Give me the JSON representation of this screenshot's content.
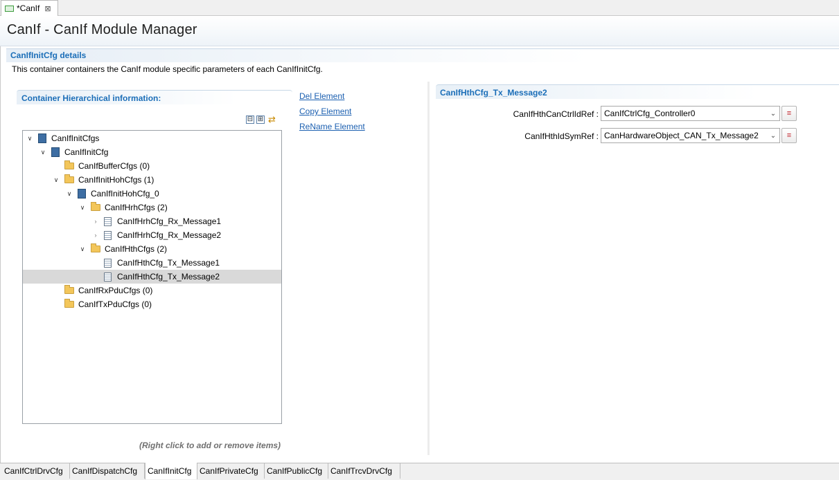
{
  "editor_tab": {
    "label": "*CanIf",
    "close": "⊠"
  },
  "form": {
    "title": "CanIf - CanIf Module Manager"
  },
  "section": {
    "title": "CanIfInitCfg details",
    "description": "This container containers the CanIf module specific parameters of each CanIfInitCfg."
  },
  "hierarchy": {
    "title": "Container Hierarchical information:",
    "hint": "(Right click to add or remove items)",
    "tools": [
      "⊟",
      "⊞",
      "⇄"
    ],
    "tree": [
      {
        "label": "CanIfInitCfgs",
        "twisty": "v",
        "icon": "book"
      },
      {
        "label": "CanIfInitCfg",
        "twisty": "v",
        "icon": "book"
      },
      {
        "label": "CanIfBufferCfgs (0)",
        "twisty": "",
        "icon": "folder"
      },
      {
        "label": "CanIfInitHohCfgs (1)",
        "twisty": "v",
        "icon": "folder"
      },
      {
        "label": "CanIfInitHohCfg_0",
        "twisty": "v",
        "icon": "book"
      },
      {
        "label": "CanIfHrhCfgs (2)",
        "twisty": "v",
        "icon": "folder"
      },
      {
        "label": "CanIfHrhCfg_Rx_Message1",
        "twisty": ">",
        "icon": "doc"
      },
      {
        "label": "CanIfHrhCfg_Rx_Message2",
        "twisty": ">",
        "icon": "doc"
      },
      {
        "label": "CanIfHthCfgs (2)",
        "twisty": "v",
        "icon": "folder"
      },
      {
        "label": "CanIfHthCfg_Tx_Message1",
        "twisty": "",
        "icon": "doc"
      },
      {
        "label": "CanIfHthCfg_Tx_Message2",
        "twisty": "",
        "icon": "doc",
        "selected": true
      },
      {
        "label": "CanIfRxPduCfgs (0)",
        "twisty": "",
        "icon": "folder"
      },
      {
        "label": "CanIfTxPduCfgs (0)",
        "twisty": "",
        "icon": "folder"
      }
    ]
  },
  "actions": {
    "delete": "Del Element",
    "copy": "Copy Element",
    "rename": "ReName Element"
  },
  "detail": {
    "title": "CanIfHthCfg_Tx_Message2",
    "fields": [
      {
        "label": "CanIfHthCanCtrlIdRef :",
        "value": "CanIfCtrlCfg_Controller0"
      },
      {
        "label": "CanIfHthIdSymRef :",
        "value": "CanHardwareObject_CAN_Tx_Message2"
      }
    ]
  },
  "bottom_tabs": [
    {
      "label": "CanIfCtrlDrvCfg"
    },
    {
      "label": "CanIfDispatchCfg"
    },
    {
      "label": "CanIfInitCfg",
      "active": true
    },
    {
      "label": "CanIfPrivateCfg"
    },
    {
      "label": "CanIfPublicCfg"
    },
    {
      "label": "CanIfTrcvDrvCfg"
    }
  ]
}
